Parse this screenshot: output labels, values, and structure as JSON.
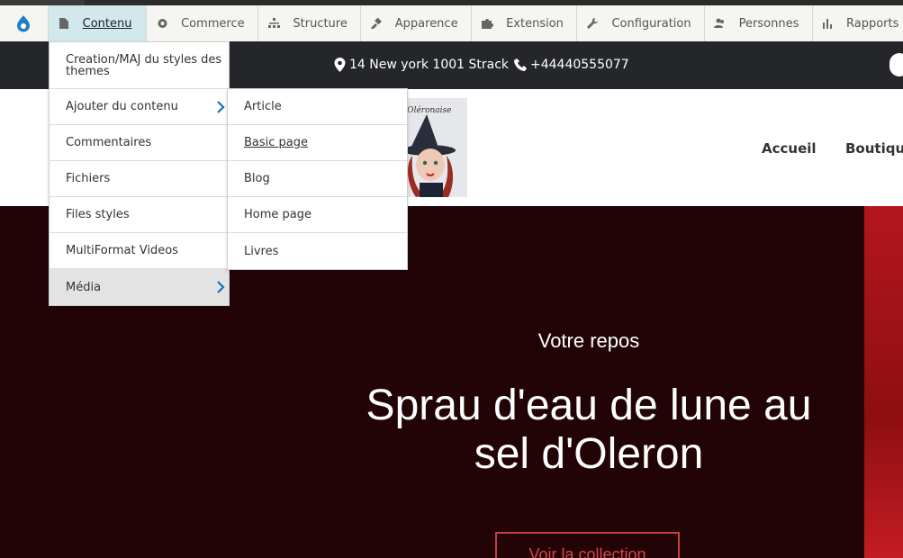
{
  "toolbar": {
    "home_icon": "drupal-drop-icon",
    "items": [
      {
        "label": "Contenu",
        "icon": "page-icon",
        "active": true
      },
      {
        "label": "Commerce",
        "icon": "commerce-icon"
      },
      {
        "label": "Structure",
        "icon": "sitemap-icon"
      },
      {
        "label": "Apparence",
        "icon": "paintbrush-icon"
      },
      {
        "label": "Extension",
        "icon": "puzzle-icon"
      },
      {
        "label": "Configuration",
        "icon": "wrench-icon"
      },
      {
        "label": "Personnes",
        "icon": "people-icon"
      },
      {
        "label": "Rapports",
        "icon": "bar-chart-icon"
      }
    ]
  },
  "header": {
    "address": "14 New york 1001 Strack",
    "phone": "+44440555077"
  },
  "nav": {
    "home": "Accueil",
    "shop": "Boutique"
  },
  "logo_text": "e Oléronaise",
  "menu_content": {
    "items": [
      {
        "label": "Creation/MAJ du styles des themes"
      },
      {
        "label": "Ajouter du contenu",
        "has_submenu": true
      },
      {
        "label": "Commentaires"
      },
      {
        "label": "Fichiers"
      },
      {
        "label": "Files styles"
      },
      {
        "label": "MultiFormat Videos"
      },
      {
        "label": "Média",
        "has_submenu": true
      }
    ]
  },
  "menu_add": {
    "items": [
      {
        "label": "Article"
      },
      {
        "label": "Basic page"
      },
      {
        "label": "Blog"
      },
      {
        "label": "Home page"
      },
      {
        "label": "Livres"
      }
    ]
  },
  "hero": {
    "kicker": "Votre repos",
    "title": "Sprau d'eau de lune au sel d'Oleron",
    "button": "Voir la collection"
  },
  "colors": {
    "accent": "#d1e8ec",
    "hero_bg": "#220406",
    "button": "#d8444a",
    "info_bar": "#24262a"
  }
}
